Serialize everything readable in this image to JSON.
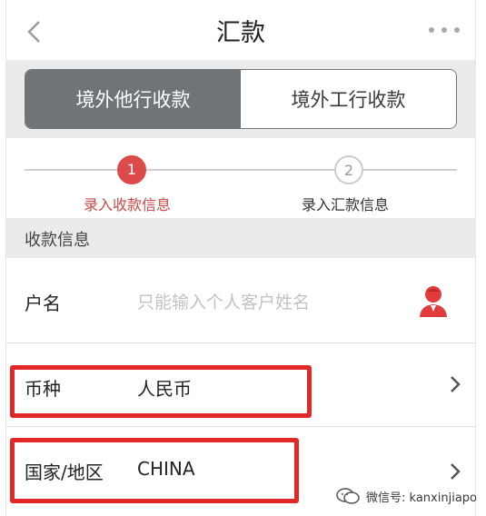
{
  "header": {
    "title": "汇款"
  },
  "tabs": [
    {
      "label": "境外他行收款",
      "active": true
    },
    {
      "label": "境外工行收款",
      "active": false
    }
  ],
  "steps": [
    {
      "number": "1",
      "label": "录入收款信息",
      "active": true
    },
    {
      "number": "2",
      "label": "录入汇款信息",
      "active": false
    }
  ],
  "section": {
    "title": "收款信息"
  },
  "form": {
    "name": {
      "label": "户名",
      "placeholder": "只能输入个人客户姓名"
    },
    "currency": {
      "label": "币种",
      "value": "人民币"
    },
    "country": {
      "label": "国家/地区",
      "value": "CHINA"
    }
  },
  "watermark": {
    "text": "微信号: kanxinjiapo"
  },
  "colors": {
    "accent": "#dc4a4a",
    "tab_active": "#6e7478",
    "highlight": "#e02828"
  }
}
